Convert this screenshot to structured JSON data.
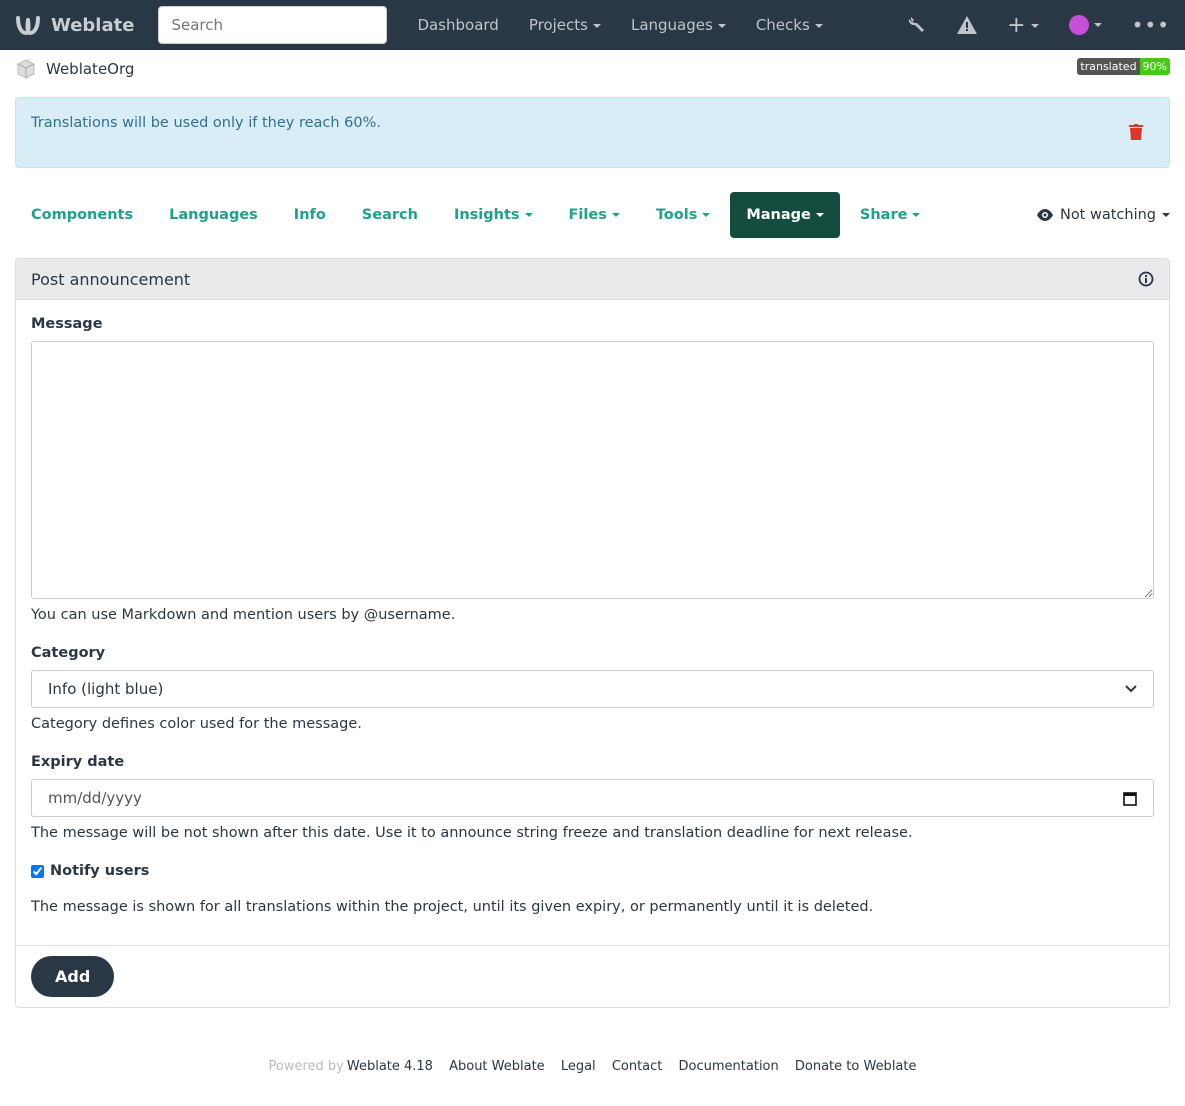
{
  "nav": {
    "brand": "Weblate",
    "search_placeholder": "Search",
    "items": [
      {
        "label": "Dashboard",
        "caret": false
      },
      {
        "label": "Projects",
        "caret": true
      },
      {
        "label": "Languages",
        "caret": true
      },
      {
        "label": "Checks",
        "caret": true
      }
    ]
  },
  "breadcrumb": {
    "project": "WeblateOrg"
  },
  "badge": {
    "label": "translated",
    "value": "90%",
    "value_color": "#4c1"
  },
  "alert": {
    "text": "Translations will be used only if they reach 60%."
  },
  "tabs": [
    {
      "label": "Components",
      "caret": false
    },
    {
      "label": "Languages",
      "caret": false
    },
    {
      "label": "Info",
      "caret": false
    },
    {
      "label": "Search",
      "caret": false
    },
    {
      "label": "Insights",
      "caret": true
    },
    {
      "label": "Files",
      "caret": true
    },
    {
      "label": "Tools",
      "caret": true
    },
    {
      "label": "Manage",
      "caret": true,
      "active": true
    },
    {
      "label": "Share",
      "caret": true
    }
  ],
  "watch": {
    "label": "Not watching"
  },
  "panel": {
    "title": "Post announcement",
    "message_label": "Message",
    "message_value": "",
    "message_help": "You can use Markdown and mention users by @username.",
    "category_label": "Category",
    "category_value": "Info (light blue)",
    "category_help": "Category defines color used for the message.",
    "expiry_label": "Expiry date",
    "expiry_placeholder": "mm/dd/yyyy",
    "expiry_help": "The message will be not shown after this date. Use it to announce string freeze and translation deadline for next release.",
    "notify_label": "Notify users",
    "notify_checked": true,
    "note": "The message is shown for all translations within the project, until its given expiry, or permanently until it is deleted.",
    "submit": "Add"
  },
  "footer": {
    "powered": "Powered by",
    "links": [
      "Weblate 4.18",
      "About Weblate",
      "Legal",
      "Contact",
      "Documentation",
      "Donate to Weblate"
    ]
  }
}
